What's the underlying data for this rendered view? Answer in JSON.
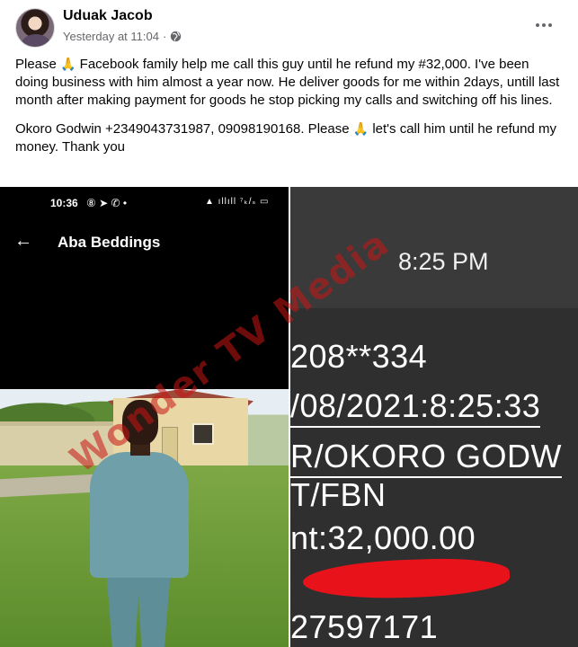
{
  "post": {
    "author": "Uduak Jacob",
    "timestamp": "Yesterday at 11:04",
    "separator": "·",
    "paragraph1": [
      "Please",
      "Facebook family help me call this guy until he refund my #32,000. I've been doing business with him almost a year now. He deliver goods for me within 2days, untill last month after making payment for goods he stop picking my calls and switching off his lines."
    ],
    "paragraph2": [
      "Okoro Godwin +2349043731987, 09098190168. Please",
      "let's call him until he refund my money. Thank you"
    ],
    "emoji": "🙏"
  },
  "screenshot_left": {
    "status_time": "10:36",
    "status_icons": "⑧ ➤ ✆ •",
    "status_right": "▲ ıllıll ⁷ₖ/ₛ ▭",
    "back_icon": "←",
    "chat_title": "Aba Beddings"
  },
  "screenshot_right": {
    "time": "8:25 PM",
    "lines": [
      "208**334",
      "/08/2021:8:25:33",
      "R/OKORO GODW",
      "T/FBN",
      "nt:32,000.00",
      "",
      "27597171"
    ]
  },
  "watermark": "Wonder TV Media",
  "colors": {
    "text": "#050505",
    "meta": "#65676b",
    "watermark": "#c81414",
    "redact": "#e8131a"
  },
  "icons": {
    "globe": "globe-icon",
    "more": "more-options-icon",
    "back": "back-arrow-icon"
  }
}
